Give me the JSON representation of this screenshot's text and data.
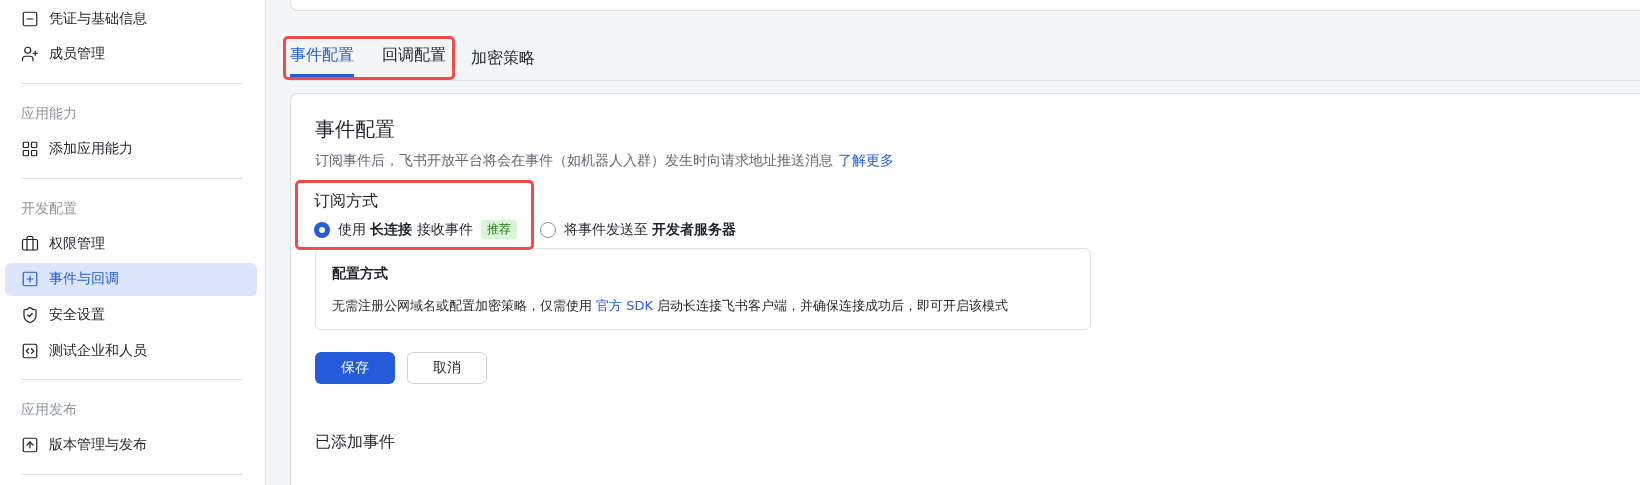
{
  "sidebar": {
    "groups": [
      {
        "items": [
          {
            "label": "凭证与基础信息",
            "selected": false
          },
          {
            "label": "成员管理",
            "selected": false
          }
        ]
      },
      {
        "title": "应用能力",
        "items": [
          {
            "label": "添加应用能力",
            "selected": false
          }
        ]
      },
      {
        "title": "开发配置",
        "items": [
          {
            "label": "权限管理",
            "selected": false
          },
          {
            "label": "事件与回调",
            "selected": true
          },
          {
            "label": "安全设置",
            "selected": false
          },
          {
            "label": "测试企业和人员",
            "selected": false
          }
        ]
      },
      {
        "title": "应用发布",
        "items": [
          {
            "label": "版本管理与发布",
            "selected": false
          }
        ]
      }
    ]
  },
  "tabs": [
    {
      "label": "事件配置",
      "selected": true,
      "highlighted": true
    },
    {
      "label": "回调配置",
      "selected": false,
      "highlighted": true
    },
    {
      "label": "加密策略",
      "selected": false,
      "highlighted": false
    }
  ],
  "event_config": {
    "title": "事件配置",
    "description": "订阅事件后，飞书开放平台将会在事件（如机器人入群）发生时向请求地址推送消息",
    "description_link": "了解更多",
    "subscription": {
      "title": "订阅方式",
      "highlighted": true,
      "options": [
        {
          "label": "使用 **长连接** 接收事件",
          "badge": "推荐",
          "selected": true
        },
        {
          "label": "将事件发送至 **开发者服务器**",
          "selected": false
        }
      ]
    },
    "config_box": {
      "title": "配置方式",
      "text_before": "无需注册公网域名或配置加密策略，仅需使用",
      "link": "官方 SDK",
      "text_after": "启动长连接飞书客户端，并确保连接成功后，即可开启该模式"
    },
    "buttons": [
      {
        "label": "保存",
        "kind": "primary"
      },
      {
        "label": "取消",
        "kind": "secondary"
      }
    ],
    "added_events_title": "已添加事件"
  }
}
